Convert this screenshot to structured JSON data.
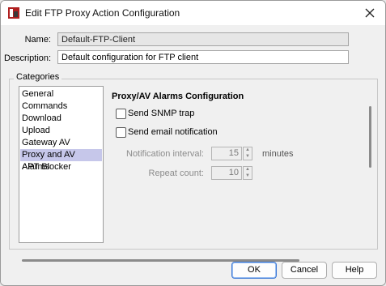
{
  "window": {
    "title": "Edit FTP Proxy Action Configuration",
    "close_icon": "close-icon"
  },
  "form": {
    "name_label": "Name:",
    "name_value": "Default-FTP-Client",
    "description_label": "Description:",
    "description_value": "Default configuration for FTP client"
  },
  "categories": {
    "legend": "Categories",
    "items": [
      "General",
      "Commands",
      "Download",
      "Upload",
      "Gateway AV",
      "Proxy and AV Alarms",
      "APT Blocker"
    ],
    "selected": "Proxy and AV Alarms"
  },
  "panel": {
    "title": "Proxy/AV Alarms Configuration",
    "send_snmp_trap": {
      "label": "Send SNMP trap",
      "checked": false
    },
    "send_email": {
      "label": "Send email notification",
      "checked": false
    },
    "notification_interval": {
      "label": "Notification interval:",
      "value": "15",
      "unit": "minutes"
    },
    "repeat_count": {
      "label": "Repeat count:",
      "value": "10"
    }
  },
  "buttons": {
    "ok": "OK",
    "cancel": "Cancel",
    "help": "Help"
  },
  "colors": {
    "selected_item_bg": "#c6c7ea",
    "primary_border": "#3b78d6"
  }
}
